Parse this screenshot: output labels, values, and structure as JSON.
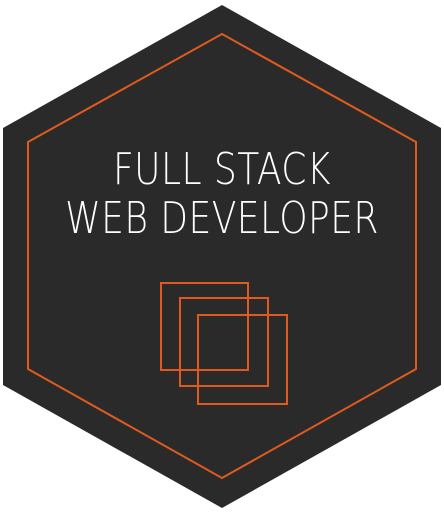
{
  "badge": {
    "line1": "FULL STACK",
    "line2": "WEB DEVELOPER",
    "colors": {
      "background": "#2a2a2a",
      "accent": "#e05a1f",
      "text": "#ffffff"
    },
    "icon": "stacked-squares-icon"
  }
}
